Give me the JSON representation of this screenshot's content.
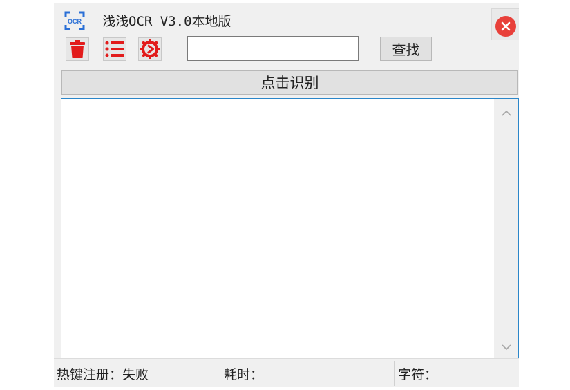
{
  "window": {
    "title": "浅浅OCR V3.0本地版",
    "logo_text": "OCR"
  },
  "toolbar": {
    "delete_icon": "trash-icon",
    "list_icon": "list-icon",
    "settings_icon": "gear-icon",
    "search_value": "",
    "search_placeholder": "",
    "find_label": "查找"
  },
  "main": {
    "recognize_label": "点击识别",
    "ocr_text": ""
  },
  "status": {
    "hotkey_label": "热键注册：",
    "hotkey_value": "失败",
    "time_label": "耗时：",
    "time_value": "",
    "chars_label": "字符：",
    "chars_value": ""
  },
  "colors": {
    "accent_red": "#e8403a",
    "logo_blue": "#2a6fd6",
    "textbox_border": "#2b86c9"
  }
}
